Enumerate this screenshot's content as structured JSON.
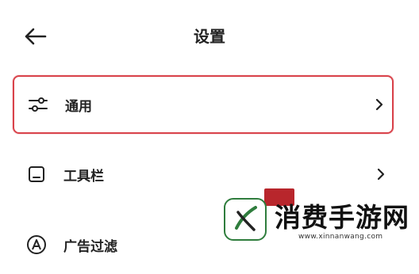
{
  "header": {
    "title": "设置"
  },
  "settings": {
    "items": [
      {
        "label": "通用",
        "icon": "sliders-icon",
        "selected": true
      },
      {
        "label": "工具栏",
        "icon": "toolbar-icon",
        "selected": false
      },
      {
        "label": "广告过滤",
        "icon": "ad-filter-icon",
        "selected": false
      }
    ]
  },
  "watermark": {
    "text": "消费手游网",
    "url": "www.xinnanwang.com"
  },
  "colors": {
    "selected_border": "#d9434b",
    "text": "#222222",
    "watermark_green": "#2f7d3d",
    "watermark_red": "#b8262c"
  }
}
